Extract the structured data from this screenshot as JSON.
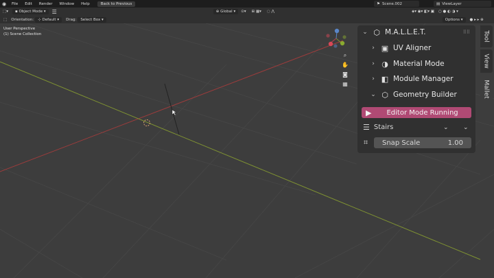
{
  "menubar": {
    "items": [
      "File",
      "Edit",
      "Render",
      "Window",
      "Help"
    ],
    "back_button": "Back to Previous",
    "scene": "Scene.002",
    "view_layer": "ViewLayer"
  },
  "header": {
    "mode": "Object Mode",
    "transform_space": "Global"
  },
  "toolbar": {
    "orientation_label": "Orientation:",
    "orientation_value": "Default",
    "drag_label": "Drag:",
    "drag_value": "Select Box",
    "options": "Options"
  },
  "viewport": {
    "perspective": "User Perspective",
    "collection": "(1) Scene Collection"
  },
  "panel": {
    "title": "M.A.L.L.E.T.",
    "sections": [
      {
        "label": "UV Aligner",
        "icon": "uv-icon"
      },
      {
        "label": "Material Mode",
        "icon": "material-sphere-icon"
      },
      {
        "label": "Module Manager",
        "icon": "module-icon"
      },
      {
        "label": "Geometry Builder",
        "icon": "cube-icon"
      }
    ],
    "run_button": "Editor Mode Running",
    "preset_select": "Stairs",
    "snap_label": "Snap Scale",
    "snap_value": "1.00"
  },
  "side_tabs": [
    "Tool",
    "View",
    "Mallet"
  ],
  "colors": {
    "accent_run": "#b04a74",
    "axis_x": "#9c3c3c",
    "axis_y": "#7f9232"
  }
}
